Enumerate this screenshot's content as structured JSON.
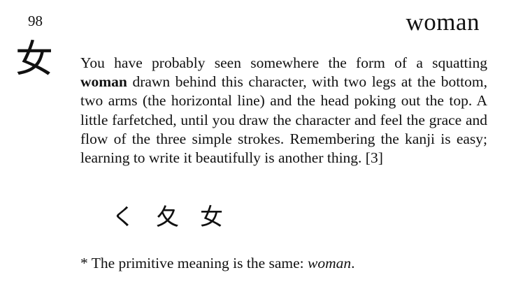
{
  "frame_number": "98",
  "keyword": "woman",
  "kanji": "女",
  "story": {
    "part_before": "You have probably seen somewhere the form of a squatting ",
    "bold_word": "woman",
    "part_after": " drawn behind this character, with two legs at the bot­tom, two arms (the horizontal line) and the head poking out the top. A little farfetched, until you draw the character and feel the grace and flow of the three simple strokes. Remember­ing the kanji is easy; learning to write it beautifully is another thing. [3]"
  },
  "stroke_order": [
    "く",
    "夂",
    "女"
  ],
  "primitive_note": {
    "prefix": "* The primitive meaning is the same: ",
    "italic_word": "woman",
    "suffix": "."
  }
}
